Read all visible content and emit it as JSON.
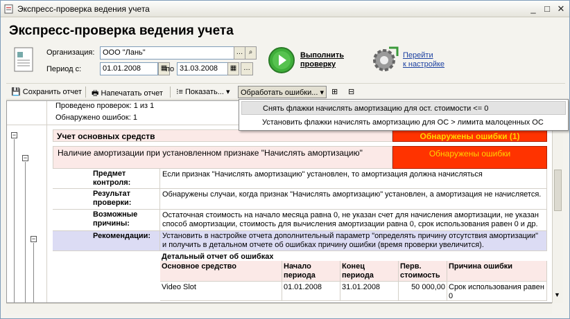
{
  "window": {
    "title": "Экспресс-проверка ведения учета"
  },
  "heading": "Экспресс-проверка ведения учета",
  "form": {
    "org_label": "Организация:",
    "org_value": "ООО \"Лань\"",
    "period_label": "Период с:",
    "period_from": "01.01.2008",
    "period_to_label": "по",
    "period_to": "31.03.2008"
  },
  "actions": {
    "run_line1": "Выполнить",
    "run_line2": "проверку",
    "settings_line1": "Перейти",
    "settings_line2": "к настройке"
  },
  "toolbar": {
    "save": "Сохранить отчет",
    "print": "Напечатать отчет",
    "show": "Показать...",
    "process": "Обработать ошибки..."
  },
  "menu": {
    "items": [
      "Снять флажки начислять амортизацию для ост. стоимости <= 0",
      "Установить флажки начислять амортизацию для ОС > лимита малоценных ОС"
    ]
  },
  "report": {
    "checks_done": "Проведено проверок: 1 из 1",
    "errors_found": "Обнаружено ошибок: 1",
    "section_title": "Учет основных средств",
    "section_status": "Обнаружены ошибки (1)",
    "check_title": "Наличие амортизации при установленном признаке \"Начислять амортизацию\"",
    "check_status": "Обнаружены ошибки",
    "rows": [
      {
        "label": "Предмет контроля:",
        "text": "Если признак \"Начислять амортизацию\" установлен, то амортизация должна начисляться"
      },
      {
        "label": "Результат проверки:",
        "text": "Обнаружены случаи, когда признак \"Начислять амортизацию\" установлен, а амортизация не начисляется."
      },
      {
        "label": "Возможные причины:",
        "text": "Остаточная стоимость на начало месяца равна 0, не указан счет для начисления амортизации, не указан способ амортизации, стоимость для вычисления амортизации равна 0, срок использования равен 0 и др."
      },
      {
        "label": "Рекомендации:",
        "text": "Установить в настройке отчета дополнительный параметр \"определять причину отсутствия амортизации\" и получить в детальном отчете об ошибках причину ошибки (время проверки увеличится)."
      }
    ],
    "detail_title": "Детальный отчет об ошибках",
    "detail_headers": [
      "Основное средство",
      "Начало периода",
      "Конец периода",
      "Перв. стоимость",
      "Причина ошибки"
    ],
    "detail_rows": [
      [
        "Video Slot",
        "01.01.2008",
        "31.01.2008",
        "50 000,00",
        "Срок использования равен 0"
      ]
    ]
  },
  "colors": {
    "error_red": "#ff3300",
    "section_bg": "#fbe9e7",
    "recommend_bg": "#dcdcf4",
    "header_bg": "#fbe9e7"
  }
}
